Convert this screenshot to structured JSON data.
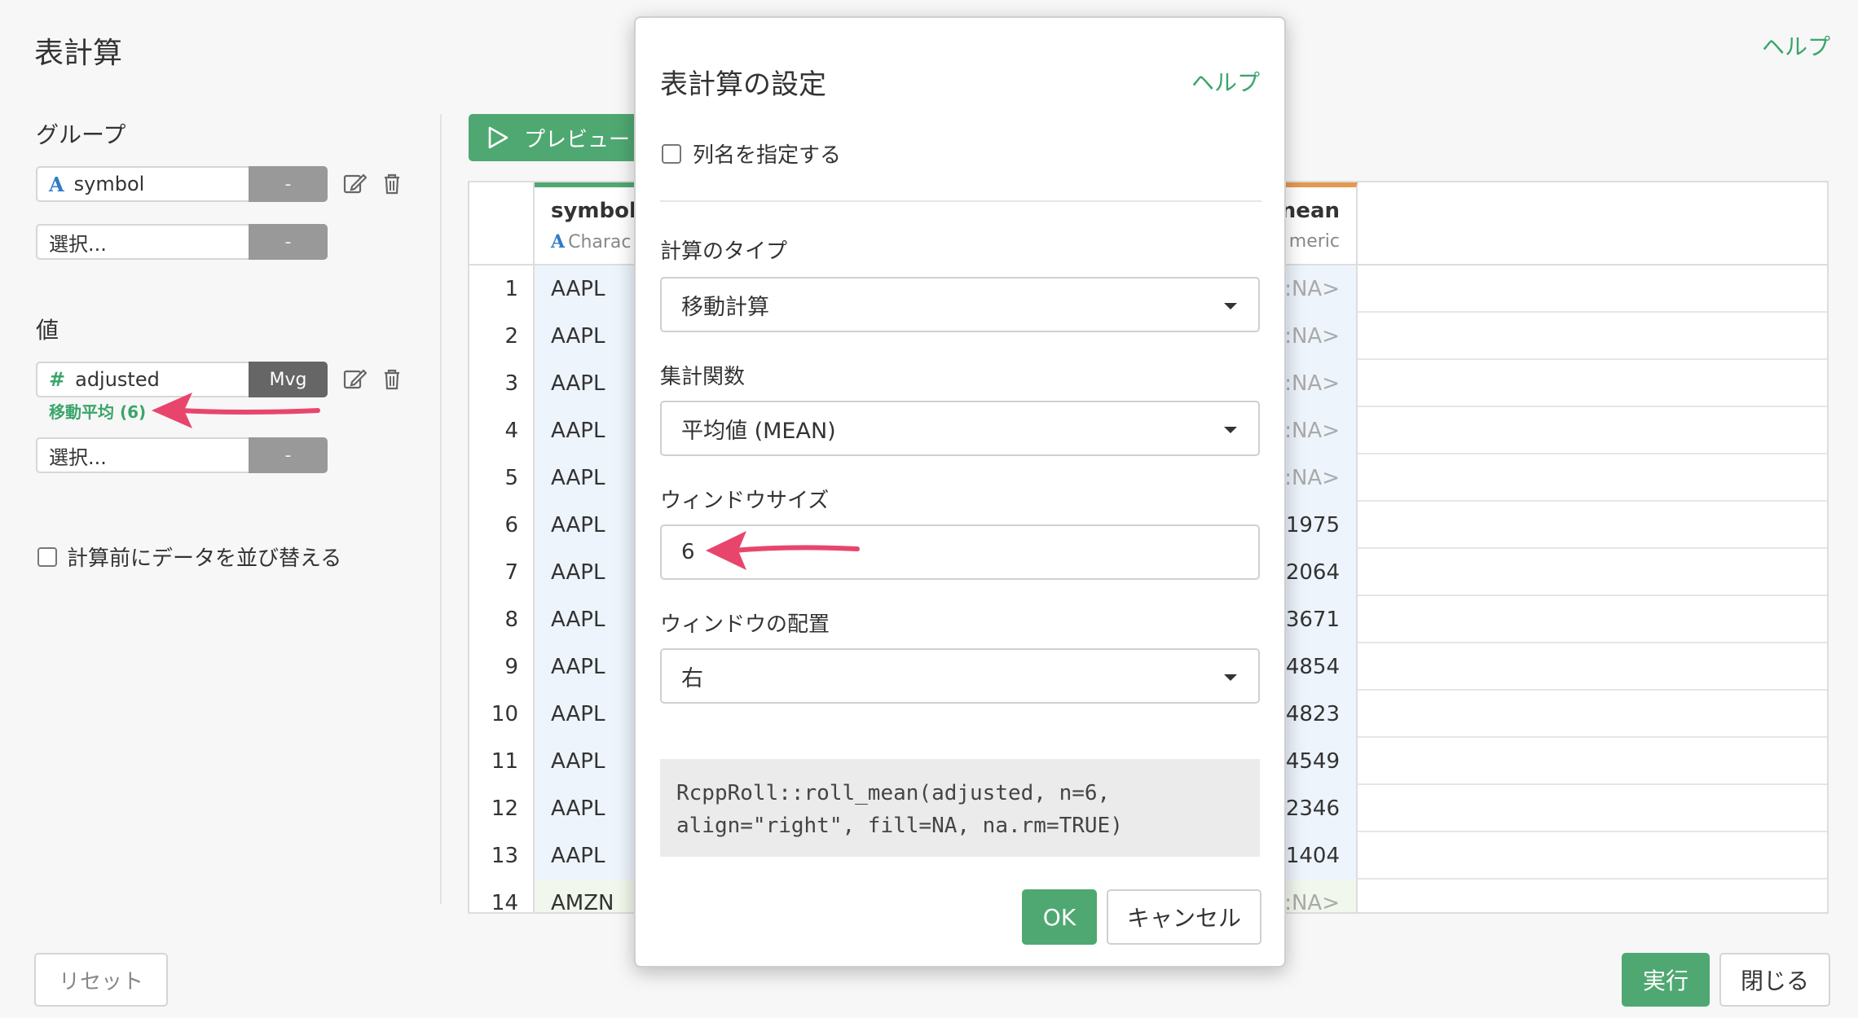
{
  "page": {
    "title": "表計算",
    "help": "ヘルプ"
  },
  "left": {
    "group_label": "グループ",
    "group_field": {
      "type_icon": "A",
      "name": "symbol",
      "btn": "-"
    },
    "group_select": {
      "placeholder": "選択...",
      "btn": "-"
    },
    "value_label": "値",
    "value_field": {
      "type_icon": "#",
      "name": "adjusted",
      "btn": "Mvg"
    },
    "value_note": "移動平均 (6)",
    "value_select": {
      "placeholder": "選択...",
      "btn": "-"
    },
    "sort_label": "計算前にデータを並び替える",
    "reset": "リセット"
  },
  "footer": {
    "run": "実行",
    "close": "閉じる"
  },
  "preview": {
    "label": "プレビュー"
  },
  "table": {
    "sym_col": {
      "name": "symbol",
      "type_icon": "A",
      "type": "Charac"
    },
    "mean_col": {
      "name": "nean",
      "type": "meric"
    },
    "rows": [
      {
        "n": "1",
        "sym": "AAPL",
        "mean": ":NA>"
      },
      {
        "n": "2",
        "sym": "AAPL",
        "mean": ":NA>"
      },
      {
        "n": "3",
        "sym": "AAPL",
        "mean": ":NA>"
      },
      {
        "n": "4",
        "sym": "AAPL",
        "mean": ":NA>"
      },
      {
        "n": "5",
        "sym": "AAPL",
        "mean": ":NA>"
      },
      {
        "n": "6",
        "sym": "AAPL",
        "mean": "1975"
      },
      {
        "n": "7",
        "sym": "AAPL",
        "mean": "2064"
      },
      {
        "n": "8",
        "sym": "AAPL",
        "mean": "3671"
      },
      {
        "n": "9",
        "sym": "AAPL",
        "mean": "4854"
      },
      {
        "n": "10",
        "sym": "AAPL",
        "mean": "4823"
      },
      {
        "n": "11",
        "sym": "AAPL",
        "mean": "4549"
      },
      {
        "n": "12",
        "sym": "AAPL",
        "mean": "2346"
      },
      {
        "n": "13",
        "sym": "AAPL",
        "mean": "1404"
      },
      {
        "n": "14",
        "sym": "AMZN",
        "mean": ":NA>"
      }
    ]
  },
  "modal": {
    "title": "表計算の設定",
    "help": "ヘルプ",
    "colname_label": "列名を指定する",
    "calc_type_label": "計算のタイプ",
    "calc_type_value": "移動計算",
    "agg_label": "集計関数",
    "agg_value": "平均値 (MEAN)",
    "window_label": "ウィンドウサイズ",
    "window_value": "6",
    "align_label": "ウィンドウの配置",
    "align_value": "右",
    "code": "RcppRoll::roll_mean(adjusted, n=6,\nalign=\"right\", fill=NA, na.rm=TRUE)",
    "ok": "OK",
    "cancel": "キャンセル"
  },
  "colors": {
    "accent_green": "#4fa871",
    "annotation_arrow": "#e8456d",
    "type_char_blue": "#2f7cc7",
    "numeric_orange": "#e39a4f"
  }
}
